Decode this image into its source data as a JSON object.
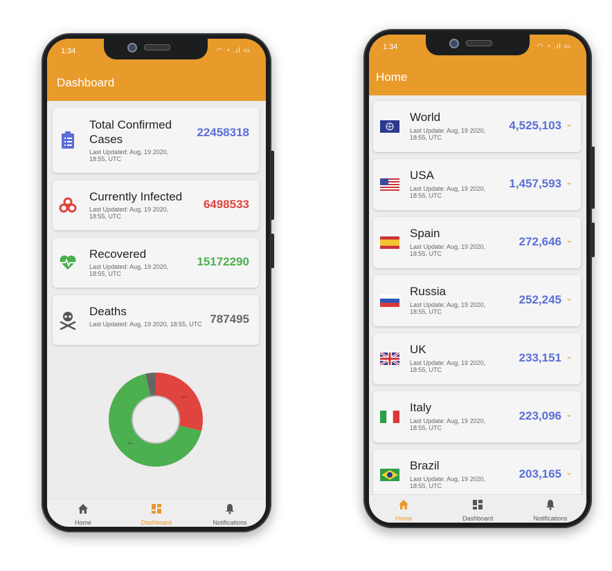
{
  "phone_left": {
    "status_time": "1:34",
    "title": "Dashboard",
    "accent": "#e89a2b",
    "cards": [
      {
        "label": "Total Confirmed Cases",
        "sub": "Last Updated: Aug, 19 2020, 18:55, UTC",
        "value": "22458318",
        "color": "#5b6ed8",
        "icon": "clipboard-icon"
      },
      {
        "label": "Currently Infected",
        "sub": "Last Updated: Aug, 19 2020, 18:55, UTC",
        "value": "6498533",
        "color": "#e0443e",
        "icon": "biohazard-icon"
      },
      {
        "label": "Recovered",
        "sub": "Last Updated: Aug, 19 2020, 18:55, UTC",
        "value": "15172290",
        "color": "#4caf50",
        "icon": "heartbeat-icon"
      },
      {
        "label": "Deaths",
        "sub": "Last Updated: Aug, 19 2020, 18:55, UTC",
        "value": "787495",
        "color": "#666666",
        "icon": "skull-icon"
      }
    ],
    "chart_data": {
      "type": "pie",
      "categories": [
        "Currently Infected",
        "Recovered",
        "Deaths"
      ],
      "values": [
        28.9,
        67.6,
        3.5
      ],
      "colors": [
        "#e0443e",
        "#4caf50",
        "#666666"
      ]
    },
    "nav": [
      {
        "label": "Home",
        "icon": "home-icon",
        "active": false
      },
      {
        "label": "Dashboard",
        "icon": "dashboard-icon",
        "active": true
      },
      {
        "label": "Notifications",
        "icon": "bell-icon",
        "active": false
      }
    ]
  },
  "phone_right": {
    "status_time": "1:34",
    "title": "Home",
    "countries": [
      {
        "name": "World",
        "sub": "Last Update: Aug, 19 2020, 18:55, UTC",
        "value": "4,525,103",
        "flag": "world-flag-icon"
      },
      {
        "name": "USA",
        "sub": "Last Update: Aug, 19 2020, 18:55, UTC",
        "value": "1,457,593",
        "flag": "usa-flag-icon"
      },
      {
        "name": "Spain",
        "sub": "Last Update: Aug, 19 2020, 18:55, UTC",
        "value": "272,646",
        "flag": "spain-flag-icon"
      },
      {
        "name": "Russia",
        "sub": "Last Update: Aug, 19 2020, 18:55, UTC",
        "value": "252,245",
        "flag": "russia-flag-icon"
      },
      {
        "name": "UK",
        "sub": "Last Update: Aug, 19 2020, 18:55, UTC",
        "value": "233,151",
        "flag": "uk-flag-icon"
      },
      {
        "name": "Italy",
        "sub": "Last Update: Aug, 19 2020, 18:55, UTC",
        "value": "223,096",
        "flag": "italy-flag-icon"
      },
      {
        "name": "Brazil",
        "sub": "Last Update: Aug, 19 2020, 18:55, UTC",
        "value": "203,165",
        "flag": "brazil-flag-icon"
      }
    ],
    "value_color": "#5b6ed8",
    "nav": [
      {
        "label": "Home",
        "icon": "home-icon",
        "active": true
      },
      {
        "label": "Dashboard",
        "icon": "dashboard-icon",
        "active": false
      },
      {
        "label": "Notifications",
        "icon": "bell-icon",
        "active": false
      }
    ]
  }
}
